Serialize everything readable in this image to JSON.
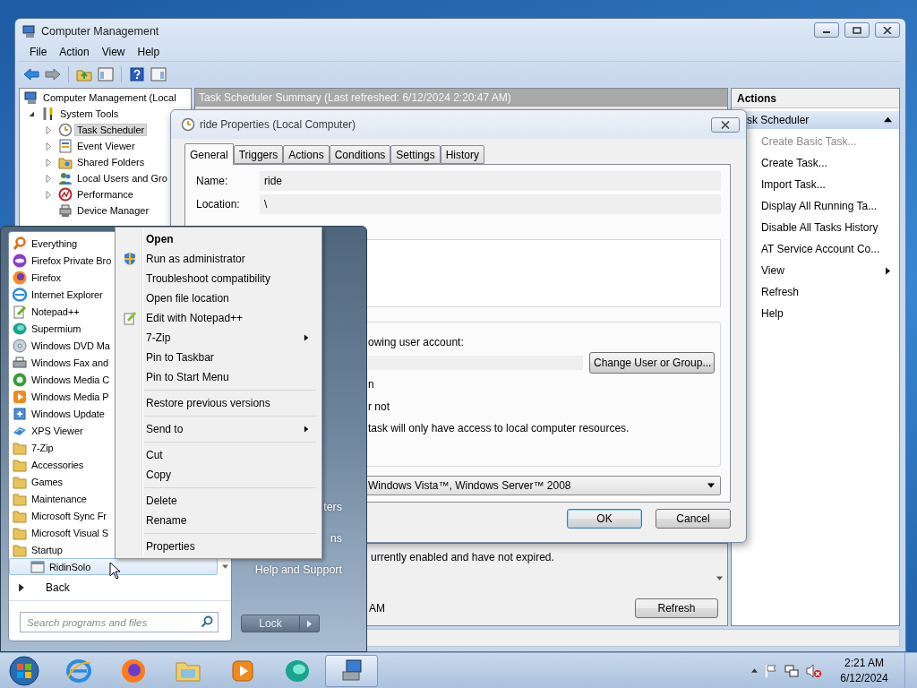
{
  "main_window": {
    "title": "Computer Management",
    "menu": [
      "File",
      "Action",
      "View",
      "Help"
    ],
    "tree": [
      {
        "label": "Computer Management (Local",
        "selected": false,
        "children": [
          {
            "label": "System Tools",
            "selected": false,
            "expanded": true,
            "children": [
              {
                "label": "Task Scheduler",
                "selected": true,
                "expanded": false
              },
              {
                "label": "Event Viewer",
                "selected": false,
                "expanded": false
              },
              {
                "label": "Shared Folders",
                "selected": false,
                "expanded": false
              },
              {
                "label": "Local Users and Gro",
                "selected": false,
                "expanded": false
              },
              {
                "label": "Performance",
                "selected": false,
                "expanded": false
              },
              {
                "label": "Device Manager",
                "selected": false
              }
            ]
          }
        ]
      }
    ],
    "summary": {
      "header": "Task Scheduler Summary (Last refreshed: 6/12/2024 2:20:47 AM)",
      "status_text": "urrently enabled and have not expired.",
      "time_text": "AM",
      "refresh_button": "Refresh"
    },
    "actions": {
      "title": "Actions",
      "section": "sk Scheduler",
      "section_expanded": true,
      "items": [
        {
          "label": "Create Basic Task...",
          "disabled": true,
          "submenu": false
        },
        {
          "label": "Create Task...",
          "disabled": false,
          "submenu": false
        },
        {
          "label": "Import Task...",
          "disabled": false,
          "submenu": false
        },
        {
          "label": "Display All Running Ta...",
          "disabled": false,
          "submenu": false
        },
        {
          "label": "Disable All Tasks History",
          "disabled": false,
          "submenu": false
        },
        {
          "label": "AT Service Account Co...",
          "disabled": false,
          "submenu": false
        },
        {
          "label": "View",
          "disabled": false,
          "submenu": true
        },
        {
          "label": "Refresh",
          "disabled": false,
          "submenu": false
        },
        {
          "label": "Help",
          "disabled": false,
          "submenu": false
        }
      ]
    }
  },
  "dialog": {
    "title": "ride Properties (Local Computer)",
    "tabs": [
      {
        "label": "General",
        "selected": true
      },
      {
        "label": "Triggers",
        "selected": false
      },
      {
        "label": "Actions",
        "selected": false
      },
      {
        "label": "Conditions",
        "selected": false
      },
      {
        "label": "Settings",
        "selected": false
      },
      {
        "label": "History",
        "selected": false
      }
    ],
    "fields": [
      {
        "label": "Name:",
        "value": "ride",
        "kind": "field"
      },
      {
        "label": "Location:",
        "value": "\\",
        "kind": "field"
      }
    ],
    "security": {
      "account_text": "owing user account:",
      "change_button": "Change User or Group...",
      "option_1": "n",
      "option_2": "r not",
      "note": "task will only have access to local computer resources."
    },
    "configure_for": "Windows Vista™, Windows Server™ 2008",
    "buttons": [
      {
        "label": "OK",
        "default": true
      },
      {
        "label": "Cancel",
        "default": false
      }
    ]
  },
  "start_menu": {
    "programs": [
      {
        "label": "Everything",
        "kind": "program"
      },
      {
        "label": "Firefox Private Bro",
        "kind": "program"
      },
      {
        "label": "Firefox",
        "kind": "program"
      },
      {
        "label": "Internet Explorer",
        "kind": "program"
      },
      {
        "label": "Notepad++",
        "kind": "program"
      },
      {
        "label": "Supermium",
        "kind": "program"
      },
      {
        "label": "Windows DVD Ma",
        "kind": "program"
      },
      {
        "label": "Windows Fax and",
        "kind": "program"
      },
      {
        "label": "Windows Media C",
        "kind": "program"
      },
      {
        "label": "Windows Media P",
        "kind": "program"
      },
      {
        "label": "Windows Update",
        "kind": "program"
      },
      {
        "label": "XPS Viewer",
        "kind": "program"
      },
      {
        "label": "7-Zip",
        "kind": "folder"
      },
      {
        "label": "Accessories",
        "kind": "folder"
      },
      {
        "label": "Games",
        "kind": "folder"
      },
      {
        "label": "Maintenance",
        "kind": "folder"
      },
      {
        "label": "Microsoft Sync Fr",
        "kind": "folder"
      },
      {
        "label": "Microsoft Visual S",
        "kind": "folder"
      },
      {
        "label": "Startup",
        "kind": "folder",
        "children": [
          {
            "label": "RidinSolo",
            "kind": "shortcut",
            "selected": true
          }
        ]
      }
    ],
    "back": "Back",
    "search_placeholder": "Search programs and files",
    "right_items": [
      "ters",
      "ns",
      "Help and Support"
    ],
    "lock_button": "Lock"
  },
  "context_menu": {
    "groups": [
      [
        {
          "label": "Open",
          "default": true,
          "submenu": false
        },
        {
          "label": "Run as administrator",
          "default": false,
          "submenu": false
        },
        {
          "label": "Troubleshoot compatibility",
          "default": false,
          "submenu": false
        },
        {
          "label": "Open file location",
          "default": false,
          "submenu": false
        },
        {
          "label": "Edit with Notepad++",
          "default": false,
          "submenu": false
        },
        {
          "label": "7-Zip",
          "default": false,
          "submenu": true
        },
        {
          "label": "Pin to Taskbar",
          "default": false,
          "submenu": false
        },
        {
          "label": "Pin to Start Menu",
          "default": false,
          "submenu": false
        }
      ],
      [
        {
          "label": "Restore previous versions",
          "default": false,
          "submenu": false
        }
      ],
      [
        {
          "label": "Send to",
          "default": false,
          "submenu": true
        }
      ],
      [
        {
          "label": "Cut",
          "default": false,
          "submenu": false
        },
        {
          "label": "Copy",
          "default": false,
          "submenu": false
        }
      ],
      [
        {
          "label": "Delete",
          "default": false,
          "submenu": false
        },
        {
          "label": "Rename",
          "default": false,
          "submenu": false
        }
      ],
      [
        {
          "label": "Properties",
          "default": false,
          "submenu": false
        }
      ]
    ]
  },
  "taskbar": {
    "apps": [
      {
        "selected": false
      },
      {
        "selected": false
      },
      {
        "selected": false
      },
      {
        "selected": false
      },
      {
        "selected": false
      },
      {
        "selected": true
      }
    ],
    "clock": {
      "time": "2:21 AM",
      "date": "6/12/2024"
    }
  }
}
